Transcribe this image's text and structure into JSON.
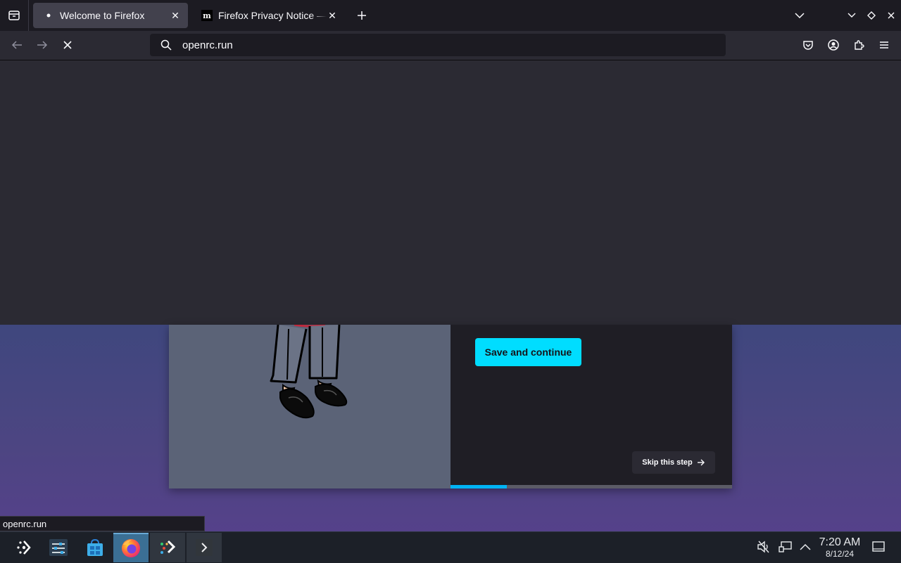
{
  "browser": {
    "tabs": [
      {
        "title": "Welcome to Firefox",
        "active": true,
        "favicon": "dot-icon"
      },
      {
        "title": "Firefox Privacy Notice — M",
        "active": false,
        "favicon": "mozilla-m-icon"
      }
    ],
    "url": "openrc.run",
    "loading": true
  },
  "page": {
    "save_button": "Save and continue",
    "skip_button": "Skip this step",
    "progress_fraction": 0.2,
    "colors": {
      "accent": "#00ddff",
      "progress": "#00b3f4"
    }
  },
  "status_panel": {
    "text": "openrc.run"
  },
  "taskbar": {
    "apps": [
      "application-launcher-icon",
      "system-settings-icon",
      "discover-store-icon",
      "firefox-icon",
      "sticker-app-icon",
      "terminal-icon"
    ],
    "clock": {
      "time": "7:20 AM",
      "date": "8/12/24"
    }
  }
}
